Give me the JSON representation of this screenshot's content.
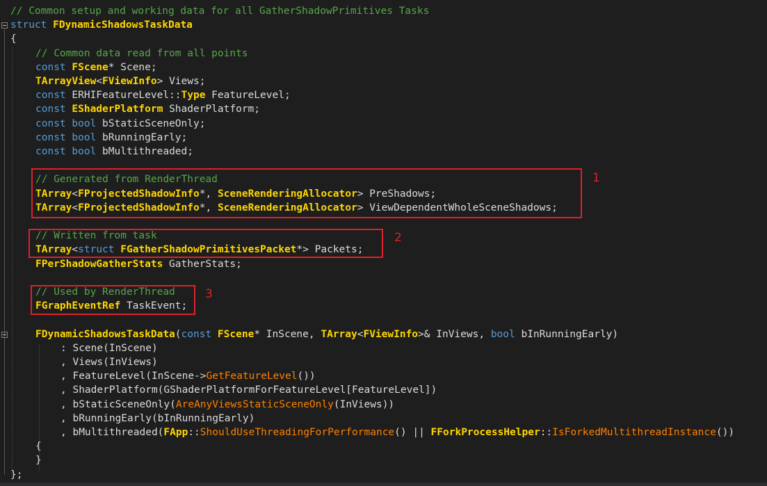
{
  "colors": {
    "background": "#1e1e1e",
    "comment": "#57a64a",
    "keyword": "#569cd6",
    "type": "#ffd700",
    "function": "#ff8000",
    "text": "#dcdcdc",
    "annotation": "#e0202a"
  },
  "icons": [
    "collapse-icon"
  ],
  "annotations": {
    "box1": "1",
    "box2": "2",
    "box3": "3"
  },
  "lines": [
    [
      [
        "comment",
        "// Common setup and working data for all GatherShadowPrimitives Tasks"
      ]
    ],
    [
      [
        "keyword",
        "struct"
      ],
      [
        "plain",
        " "
      ],
      [
        "type",
        "FDynamicShadowsTaskData"
      ]
    ],
    [
      [
        "plain",
        "{"
      ]
    ],
    [
      [
        "comment",
        "// Common data read from all points"
      ]
    ],
    [
      [
        "keyword",
        "const"
      ],
      [
        "plain",
        " "
      ],
      [
        "type",
        "FScene"
      ],
      [
        "plain",
        "* Scene;"
      ]
    ],
    [
      [
        "type",
        "TArrayView"
      ],
      [
        "plain",
        "<"
      ],
      [
        "type",
        "FViewInfo"
      ],
      [
        "plain",
        "> Views;"
      ]
    ],
    [
      [
        "keyword",
        "const"
      ],
      [
        "plain",
        " ERHIFeatureLevel::"
      ],
      [
        "type",
        "Type"
      ],
      [
        "plain",
        " FeatureLevel;"
      ]
    ],
    [
      [
        "keyword",
        "const"
      ],
      [
        "plain",
        " "
      ],
      [
        "type",
        "EShaderPlatform"
      ],
      [
        "plain",
        " ShaderPlatform;"
      ]
    ],
    [
      [
        "keyword",
        "const"
      ],
      [
        "plain",
        " "
      ],
      [
        "keyword",
        "bool"
      ],
      [
        "plain",
        " bStaticSceneOnly;"
      ]
    ],
    [
      [
        "keyword",
        "const"
      ],
      [
        "plain",
        " "
      ],
      [
        "keyword",
        "bool"
      ],
      [
        "plain",
        " bRunningEarly;"
      ]
    ],
    [
      [
        "keyword",
        "const"
      ],
      [
        "plain",
        " "
      ],
      [
        "keyword",
        "bool"
      ],
      [
        "plain",
        " bMultithreaded;"
      ]
    ],
    [],
    [
      [
        "comment",
        "// Generated from RenderThread"
      ]
    ],
    [
      [
        "type",
        "TArray"
      ],
      [
        "plain",
        "<"
      ],
      [
        "type",
        "FProjectedShadowInfo"
      ],
      [
        "plain",
        "*, "
      ],
      [
        "type",
        "SceneRenderingAllocator"
      ],
      [
        "plain",
        "> PreShadows;"
      ]
    ],
    [
      [
        "type",
        "TArray"
      ],
      [
        "plain",
        "<"
      ],
      [
        "type",
        "FProjectedShadowInfo"
      ],
      [
        "plain",
        "*, "
      ],
      [
        "type",
        "SceneRenderingAllocator"
      ],
      [
        "plain",
        "> ViewDependentWholeSceneShadows;"
      ]
    ],
    [],
    [
      [
        "comment",
        "// Written from task"
      ]
    ],
    [
      [
        "type",
        "TArray"
      ],
      [
        "plain",
        "<"
      ],
      [
        "keyword",
        "struct"
      ],
      [
        "plain",
        " "
      ],
      [
        "type",
        "FGatherShadowPrimitivesPacket"
      ],
      [
        "plain",
        "*> Packets;"
      ]
    ],
    [
      [
        "type",
        "FPerShadowGatherStats"
      ],
      [
        "plain",
        " GatherStats;"
      ]
    ],
    [],
    [
      [
        "comment",
        "// Used by RenderThread"
      ]
    ],
    [
      [
        "type",
        "FGraphEventRef"
      ],
      [
        "plain",
        " TaskEvent;"
      ]
    ],
    [],
    [
      [
        "type",
        "FDynamicShadowsTaskData"
      ],
      [
        "plain",
        "("
      ],
      [
        "keyword",
        "const"
      ],
      [
        "plain",
        " "
      ],
      [
        "type",
        "FScene"
      ],
      [
        "plain",
        "* InScene, "
      ],
      [
        "type",
        "TArray"
      ],
      [
        "plain",
        "<"
      ],
      [
        "type",
        "FViewInfo"
      ],
      [
        "plain",
        ">& InViews, "
      ],
      [
        "keyword",
        "bool"
      ],
      [
        "plain",
        " bInRunningEarly)"
      ]
    ],
    [
      [
        "plain",
        ": Scene(InScene)"
      ]
    ],
    [
      [
        "plain",
        ", Views(InViews)"
      ]
    ],
    [
      [
        "plain",
        ", FeatureLevel(InScene->"
      ],
      [
        "func",
        "GetFeatureLevel"
      ],
      [
        "plain",
        "())"
      ]
    ],
    [
      [
        "plain",
        ", ShaderPlatform(GShaderPlatformForFeatureLevel[FeatureLevel])"
      ]
    ],
    [
      [
        "plain",
        ", bStaticSceneOnly("
      ],
      [
        "func",
        "AreAnyViewsStaticSceneOnly"
      ],
      [
        "plain",
        "(InViews))"
      ]
    ],
    [
      [
        "plain",
        ", bRunningEarly(bInRunningEarly)"
      ]
    ],
    [
      [
        "plain",
        ", bMultithreaded("
      ],
      [
        "type",
        "FApp"
      ],
      [
        "plain",
        "::"
      ],
      [
        "func",
        "ShouldUseThreadingForPerformance"
      ],
      [
        "plain",
        "() || "
      ],
      [
        "type",
        "FForkProcessHelper"
      ],
      [
        "plain",
        "::"
      ],
      [
        "func",
        "IsForkedMultithreadInstance"
      ],
      [
        "plain",
        "())"
      ]
    ],
    [
      [
        "plain",
        "{"
      ]
    ],
    [
      [
        "plain",
        "}"
      ]
    ],
    [
      [
        "plain",
        "};"
      ]
    ]
  ]
}
